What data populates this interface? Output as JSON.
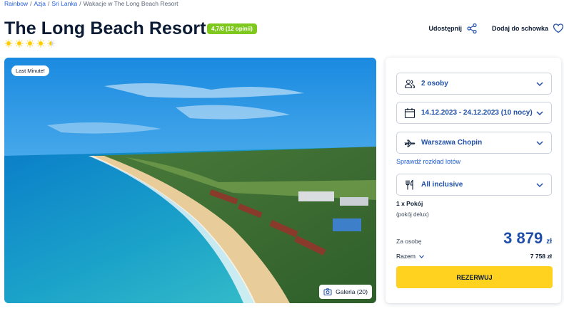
{
  "breadcrumb": {
    "items": [
      "Rainbow",
      "Azja",
      "Sri Lanka"
    ],
    "separator": "/",
    "current": "Wakacje w The Long Beach Resort"
  },
  "hotel": {
    "title": "The Long Beach Resort",
    "rating": "4,7/6 (12 opinii)",
    "stars": 4.5,
    "stars_max": 5
  },
  "actions": {
    "share": "Udostępnij",
    "save": "Dodaj do schowka"
  },
  "hero": {
    "badge": "Last Minute!",
    "gallery": "Galeria (20)"
  },
  "booking": {
    "travelers": "2 osoby",
    "dates": "14.12.2023 - 24.12.2023 (10 nocy)",
    "airport": "Warszawa Chopin",
    "flight_schedule_link": "Sprawdź rozkład lotów",
    "board": "All inclusive",
    "room_count": "1 x Pokój",
    "room_type": "(pokój delux)",
    "per_person_label": "Za osobę",
    "price_per_person": "3 879",
    "currency": "zł",
    "total_label": "Razem",
    "total": "7 758 zł",
    "book_button": "REZERWUJ"
  },
  "colors": {
    "accent_blue": "#1f4fa8",
    "link_blue": "#1f5bd6",
    "rating_green": "#7fc91f",
    "cta_yellow": "#ffd21f",
    "star_yellow": "#ffcc00"
  },
  "icons": {
    "share": "share-icon",
    "heart": "heart-icon",
    "users": "users-icon",
    "calendar": "calendar-icon",
    "plane": "plane-icon",
    "cutlery": "cutlery-icon",
    "camera": "camera-icon",
    "chevron": "chevron-down-icon"
  }
}
